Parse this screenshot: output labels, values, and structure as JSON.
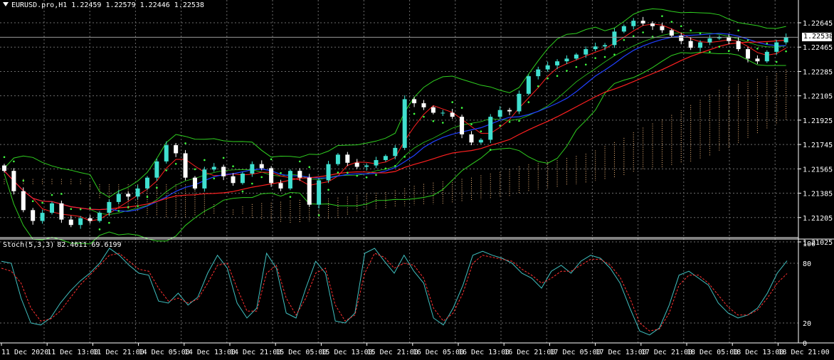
{
  "colors": {
    "background": "#000000",
    "grid": "#6b6b6b",
    "bull_candle": "#40e0d0",
    "bear_candle": "#ffffff",
    "ma_red": "#ff2020",
    "ma_blue": "#2040ff",
    "bollinger": "#30d020",
    "parabolic_sar": "#40ff40",
    "ichimoku_cloud": "#ffc080",
    "stoch_main": "#40c0c0",
    "stoch_signal": "#ff3030"
  },
  "main": {
    "symbol_label": "EURUSD.pro,H1",
    "ohlc_label": "1.22459 1.22579 1.22446 1.22538",
    "current_price": "1.22538",
    "price_labels": [
      "1.22645",
      "1.22465",
      "1.22285",
      "1.22105",
      "1.21925",
      "1.21745",
      "1.21565",
      "1.21385",
      "1.21205",
      "1.21025"
    ]
  },
  "indicator": {
    "title": "Stoch(5,3,3)",
    "values": "82.4611 69.6199",
    "levels": [
      "100",
      "80",
      "20",
      "0"
    ]
  },
  "time_labels": [
    "11 Dec 2020",
    "11 Dec 13:00",
    "11 Dec 21:00",
    "14 Dec 05:00",
    "14 Dec 13:00",
    "14 Dec 21:00",
    "15 Dec 05:00",
    "15 Dec 13:00",
    "15 Dec 21:00",
    "16 Dec 05:00",
    "16 Dec 13:00",
    "16 Dec 21:00",
    "17 Dec 05:00",
    "17 Dec 13:00",
    "17 Dec 21:00",
    "18 Dec 05:00",
    "18 Dec 13:00",
    "18 Dec 21:00"
  ],
  "chart_data": {
    "type": "line",
    "symbol": "EURUSD.pro",
    "timeframe": "H1",
    "price_range": [
      1.21025,
      1.22645
    ],
    "close": [
      1.2155,
      1.214,
      1.2126,
      1.2118,
      1.2124,
      1.2131,
      1.2119,
      1.2115,
      1.212,
      1.2118,
      1.2124,
      1.2132,
      1.2138,
      1.2136,
      1.2142,
      1.215,
      1.2162,
      1.2174,
      1.2168,
      1.215,
      1.2142,
      1.2156,
      1.2158,
      1.2151,
      1.2146,
      1.2153,
      1.216,
      1.2157,
      1.2146,
      1.2142,
      1.2155,
      1.215,
      1.213,
      1.2148,
      1.216,
      1.2167,
      1.2161,
      1.2158,
      1.2159,
      1.2163,
      1.2166,
      1.2172,
      1.2208,
      1.2205,
      1.2202,
      1.2198,
      1.2198,
      1.2195,
      1.2182,
      1.2176,
      1.2178,
      1.2195,
      1.22,
      1.2199,
      1.2212,
      1.2225,
      1.223,
      1.2233,
      1.2236,
      1.2238,
      1.2241,
      1.2245,
      1.2247,
      1.2248,
      1.2258,
      1.2262,
      1.2266,
      1.2264,
      1.2262,
      1.2259,
      1.2255,
      1.2251,
      1.2246,
      1.225,
      1.2253,
      1.2254,
      1.2251,
      1.2245,
      1.2238,
      1.2236,
      1.2243,
      1.225,
      1.22538
    ],
    "stoch_main": [
      82,
      80,
      45,
      20,
      18,
      25,
      40,
      52,
      62,
      70,
      80,
      95,
      88,
      78,
      70,
      68,
      42,
      40,
      50,
      38,
      46,
      70,
      88,
      75,
      40,
      25,
      35,
      90,
      75,
      30,
      25,
      55,
      82,
      70,
      22,
      20,
      30,
      90,
      95,
      82,
      70,
      88,
      72,
      60,
      25,
      18,
      35,
      58,
      88,
      92,
      88,
      85,
      80,
      70,
      65,
      55,
      72,
      78,
      70,
      82,
      88,
      85,
      75,
      60,
      35,
      12,
      8,
      15,
      38,
      68,
      72,
      65,
      58,
      40,
      30,
      25,
      28,
      35,
      50,
      70,
      82.4611
    ],
    "stoch_signal": [
      75,
      72,
      60,
      35,
      22,
      24,
      32,
      45,
      58,
      68,
      78,
      88,
      90,
      82,
      74,
      72,
      55,
      42,
      45,
      40,
      44,
      60,
      78,
      80,
      55,
      32,
      32,
      70,
      78,
      45,
      28,
      45,
      70,
      75,
      38,
      22,
      28,
      70,
      90,
      86,
      75,
      80,
      78,
      65,
      35,
      22,
      30,
      50,
      80,
      88,
      86,
      84,
      82,
      74,
      68,
      60,
      65,
      72,
      72,
      78,
      84,
      84,
      78,
      66,
      45,
      20,
      12,
      14,
      30,
      58,
      68,
      68,
      60,
      48,
      36,
      28,
      28,
      33,
      45,
      60,
      69.6199
    ],
    "stoch_levels": [
      20,
      80
    ],
    "stoch_range": [
      0,
      100
    ]
  }
}
